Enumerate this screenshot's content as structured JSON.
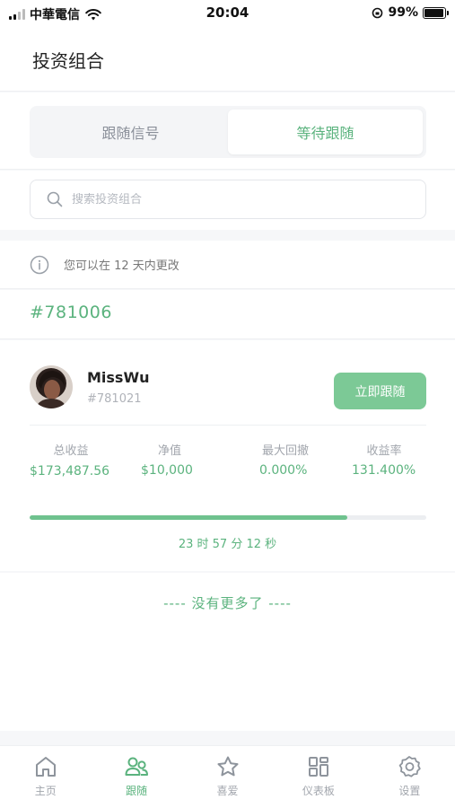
{
  "status_bar": {
    "carrier": "中華電信",
    "time": "20:04",
    "battery": "99%"
  },
  "header": {
    "title": "投资组合"
  },
  "segment": {
    "tabs": [
      {
        "label": "跟随信号",
        "active": false
      },
      {
        "label": "等待跟随",
        "active": true
      }
    ]
  },
  "search": {
    "placeholder": "搜索投资组合",
    "value": ""
  },
  "notice": {
    "text": "您可以在 12 天内更改"
  },
  "portfolio": {
    "group_id": "#781006",
    "trader": {
      "name": "MissWu",
      "id": "#781021"
    },
    "follow_button": "立即跟随",
    "stats": [
      {
        "label": "总收益",
        "value": "$173,487.56"
      },
      {
        "label": "净值",
        "value": "$10,000"
      },
      {
        "label": "最大回撤",
        "value": "0.000%"
      },
      {
        "label": "收益率",
        "value": "131.400%"
      }
    ],
    "progress_fraction": 0.8,
    "countdown": "23 时 57 分 12 秒"
  },
  "list_end_text": "---- 没有更多了 ----",
  "tab_bar": {
    "items": [
      {
        "label": "主页",
        "icon": "home-icon",
        "active": false
      },
      {
        "label": "跟随",
        "icon": "users-icon",
        "active": true
      },
      {
        "label": "喜爱",
        "icon": "star-icon",
        "active": false
      },
      {
        "label": "仪表板",
        "icon": "dashboard-icon",
        "active": false
      },
      {
        "label": "设置",
        "icon": "gear-icon",
        "active": false
      }
    ]
  },
  "colors": {
    "accent": "#5bb37e",
    "button": "#7cc996",
    "muted": "#a2a6ad"
  }
}
